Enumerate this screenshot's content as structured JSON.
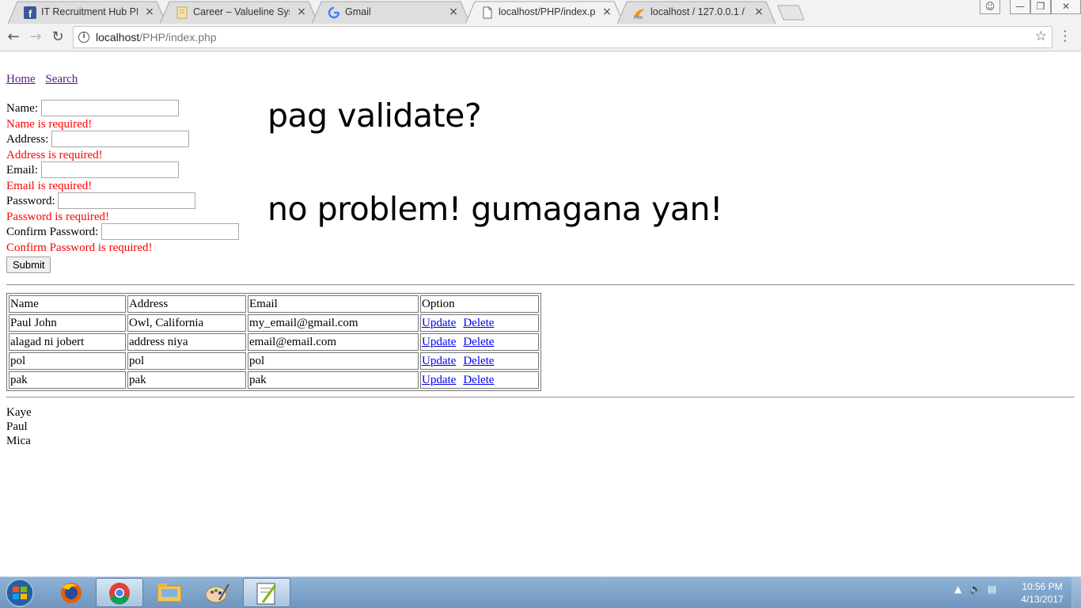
{
  "browser": {
    "tabs": [
      {
        "title": "IT Recruitment Hub PH",
        "icon": "facebook-icon",
        "active": false
      },
      {
        "title": "Career – Valueline Systems",
        "icon": "page-icon",
        "active": false
      },
      {
        "title": "Gmail",
        "icon": "google-icon",
        "active": false
      },
      {
        "title": "localhost/PHP/index.php",
        "icon": "document-icon",
        "active": true
      },
      {
        "title": "localhost / 127.0.0.1 / my",
        "icon": "phpmyadmin-icon",
        "active": false
      }
    ],
    "url_host": "localhost",
    "url_path": "/PHP/index.php"
  },
  "nav": {
    "home": "Home",
    "search": "Search"
  },
  "form": {
    "name_label": "Name:",
    "name_error": "Name is required!",
    "address_label": "Address:",
    "address_error": "Address is required!",
    "email_label": "Email:",
    "email_error": "Email is required!",
    "password_label": "Password:",
    "password_error": "Password is required!",
    "confirm_label": "Confirm Password:",
    "confirm_error": "Confirm Password is required!",
    "submit_label": "Submit"
  },
  "big_text": {
    "line1": "pag validate?",
    "line2": "no problem! gumagana yan!"
  },
  "table": {
    "headers": [
      "Name",
      "Address",
      "Email",
      "Option"
    ],
    "rows": [
      {
        "name": "Paul John",
        "address": "Owl, California",
        "email": "my_email@gmail.com"
      },
      {
        "name": "alagad ni jobert",
        "address": "address niya",
        "email": "email@email.com"
      },
      {
        "name": "pol",
        "address": "pol",
        "email": "pol"
      },
      {
        "name": "pak",
        "address": "pak",
        "email": "pak"
      }
    ],
    "update_label": "Update",
    "delete_label": "Delete"
  },
  "names_list": [
    "Kaye",
    "Paul",
    "Mica"
  ],
  "taskbar": {
    "apps": [
      "firefox-icon",
      "chrome-icon",
      "file-explorer-icon",
      "paint-icon",
      "notepad-plus-icon"
    ],
    "time": "10:56 PM",
    "date": "4/13/2017"
  },
  "colors": {
    "error": "#ff0000",
    "link": "#0000ee",
    "visited_link": "#551a8b"
  }
}
